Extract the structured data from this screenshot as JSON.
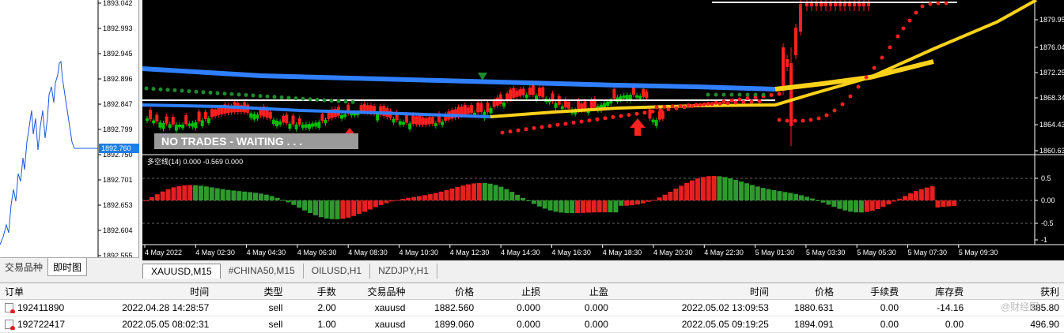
{
  "left_panel": {
    "price_labels": [
      "1893.042",
      "1892.993",
      "1892.945",
      "1892.896",
      "1892.847",
      "1892.799",
      "1892.750",
      "1892.701",
      "1892.653",
      "1892.604",
      "1892.555"
    ],
    "current_price": "1892.760",
    "tabs": [
      "交易品种",
      "即时图"
    ]
  },
  "chart": {
    "price_labels": [
      "1879.95",
      "1876.04",
      "1872.25",
      "1868.34",
      "1864.43",
      "1860.63"
    ],
    "indicator_title": "多空线(14) 0.000 -0.569 0.000",
    "indicator_labels": [
      "0.5",
      "0.00",
      "-0.5",
      "-1"
    ],
    "banner": "NO TRADES - WAITING . . .",
    "time_labels": [
      "4 May 2022",
      "4 May 02:30",
      "4 May 04:30",
      "4 May 06:30",
      "4 May 08:30",
      "4 May 10:30",
      "4 May 12:30",
      "4 May 14:30",
      "4 May 16:30",
      "4 May 18:30",
      "4 May 20:30",
      "4 May 22:30",
      "5 May 01:30",
      "5 May 03:30",
      "5 May 05:30",
      "5 May 07:30",
      "5 May 09:30"
    ],
    "colors": {
      "bull": "#00c000",
      "bear": "#ff2020",
      "blue": "#2f7fff",
      "yellow": "#ffd21a",
      "white": "#ffffff",
      "osc_green": "#2e9a2e",
      "osc_red": "#e52020"
    }
  },
  "chart_tabs": [
    "XAUUSD,M15",
    "#CHINA50,M15",
    "OILUSD,H1",
    "NZDJPY,H1"
  ],
  "orders": {
    "columns": [
      "订单",
      "时间",
      "类型",
      "手数",
      "交易品种",
      "价格",
      "止损",
      "止盈",
      "时间",
      "价格",
      "手续费",
      "库存费",
      "获利"
    ],
    "rows": [
      [
        "192411890",
        "2022.04.28 14:28:57",
        "sell",
        "2.00",
        "xauusd",
        "1882.560",
        "0.000",
        "0.000",
        "2022.05.02 13:09:53",
        "1880.631",
        "0.00",
        "-14.16",
        "385.80"
      ],
      [
        "192722417",
        "2022.05.05 08:02:31",
        "sell",
        "1.00",
        "xauusd",
        "1899.060",
        "0.000",
        "0.000",
        "2022.05.05 09:19:25",
        "1894.091",
        "0.00",
        "0.00",
        "496.90"
      ]
    ]
  },
  "watermark": "@财经圈"
}
